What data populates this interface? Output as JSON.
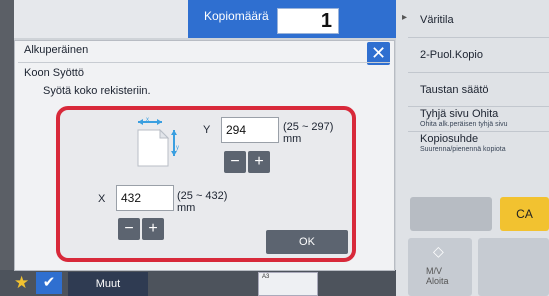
{
  "topbar": {
    "copy_count_label": "Kopiomäärä",
    "copy_count_value": "1"
  },
  "right_panel": {
    "items": [
      {
        "label": "Väritila",
        "sub": ""
      },
      {
        "label": "2-Puol.Kopio",
        "sub": ""
      },
      {
        "label": "Taustan säätö",
        "sub": ""
      },
      {
        "label": "Tyhjä sivu Ohita",
        "sub": "Ohita alk.peräisen tyhjä sivu"
      },
      {
        "label": "Kopiosuhde",
        "sub": "Suurenna/pienennä kopiota"
      }
    ],
    "ca_label": "CA",
    "mv_label": "M/V",
    "start_label": "Aloita"
  },
  "bottom_bar": {
    "more_label": "Muut",
    "tray_text": "A3"
  },
  "dialog": {
    "title": "Alkuperäinen",
    "section": "Koon Syöttö",
    "instruction": "Syötä koko rekisteriin.",
    "y_label": "Y",
    "y_value": "294",
    "y_range": "(25 ~ 297)",
    "y_unit": "mm",
    "x_label": "X",
    "x_value": "432",
    "x_range": "(25 ~ 432)",
    "x_unit": "mm",
    "minus": "−",
    "plus": "+",
    "ok_label": "OK",
    "close_glyph": "✕"
  },
  "colors": {
    "accent": "#2f6fd0",
    "highlight": "#d8293a",
    "ca": "#f2c230"
  }
}
